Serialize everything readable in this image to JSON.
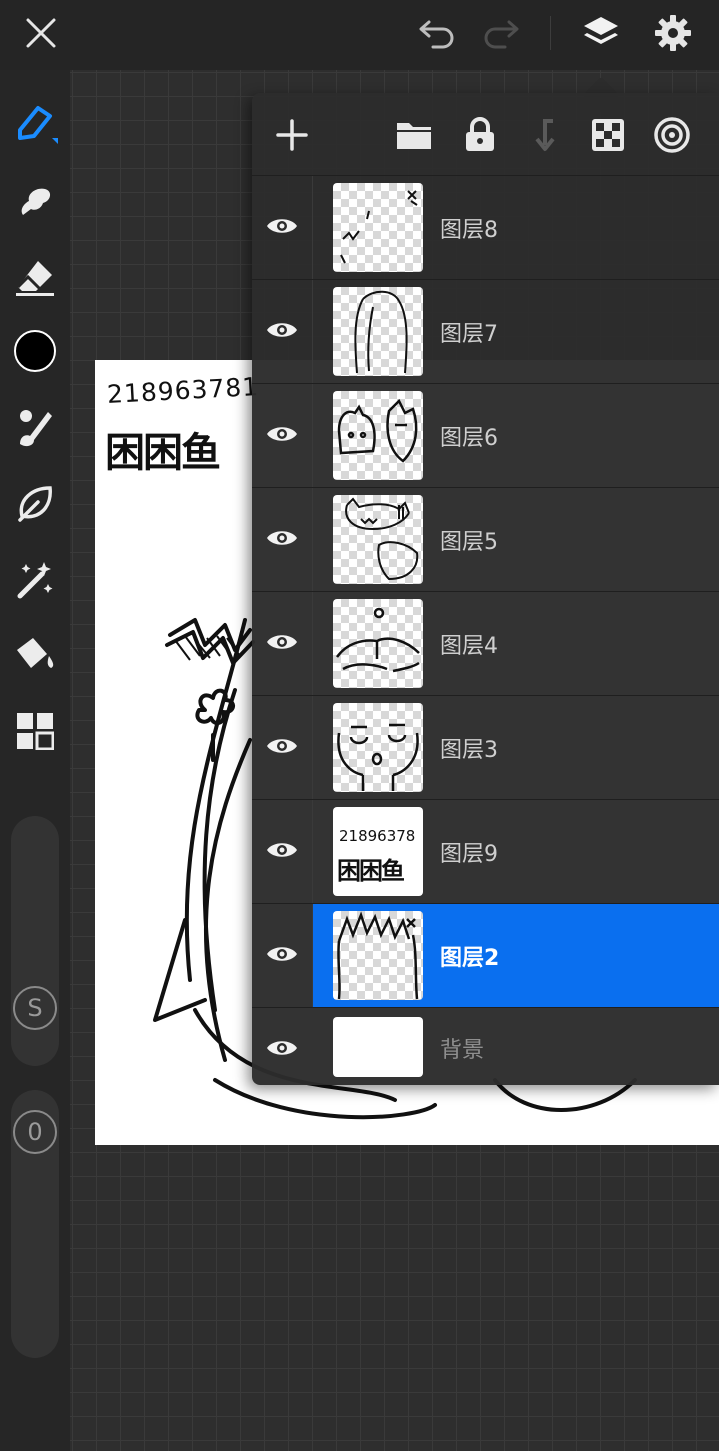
{
  "toolbar": {
    "close_icon": "close-icon",
    "undo_icon": "undo-icon",
    "redo_icon": "redo-icon",
    "layers_icon": "layers-icon",
    "settings_icon": "gear-icon"
  },
  "tools": [
    {
      "name": "pen-tool",
      "icon": "pen-icon",
      "active": true
    },
    {
      "name": "smudge-tool",
      "icon": "smudge-icon"
    },
    {
      "name": "eraser-tool",
      "icon": "eraser-icon"
    },
    {
      "name": "color-picker",
      "icon": "color-swatch",
      "color": "#000000"
    },
    {
      "name": "brush-tool",
      "icon": "brush-icon"
    },
    {
      "name": "selection-tool",
      "icon": "leaf-icon"
    },
    {
      "name": "magic-wand-tool",
      "icon": "magic-wand-icon"
    },
    {
      "name": "fill-tool",
      "icon": "paint-bucket-icon"
    },
    {
      "name": "more-tools",
      "icon": "grid-icon"
    }
  ],
  "sliders": {
    "size_label": "S",
    "opacity_label": "0"
  },
  "canvas": {
    "id_text": "218963781",
    "name_text": "困困鱼"
  },
  "layers_panel": {
    "header_icons": [
      "add-layer-icon",
      "folder-icon",
      "lock-icon",
      "merge-down-icon",
      "checker-icon",
      "target-icon"
    ],
    "layers": [
      {
        "name": "图层8",
        "visible": true,
        "selected": false
      },
      {
        "name": "图层7",
        "visible": true,
        "selected": false
      },
      {
        "name": "图层6",
        "visible": true,
        "selected": false
      },
      {
        "name": "图层5",
        "visible": true,
        "selected": false
      },
      {
        "name": "图层4",
        "visible": true,
        "selected": false
      },
      {
        "name": "图层3",
        "visible": true,
        "selected": false
      },
      {
        "name": "图层9",
        "visible": true,
        "selected": false
      },
      {
        "name": "图层2",
        "visible": true,
        "selected": true
      },
      {
        "name": "背景",
        "visible": true,
        "selected": false
      }
    ],
    "thumb_layer9_id": "21896378",
    "thumb_layer9_name": "困困鱼"
  },
  "colors": {
    "accent": "#0a6fef",
    "panel": "#2c2c2c",
    "bar": "#252525"
  }
}
